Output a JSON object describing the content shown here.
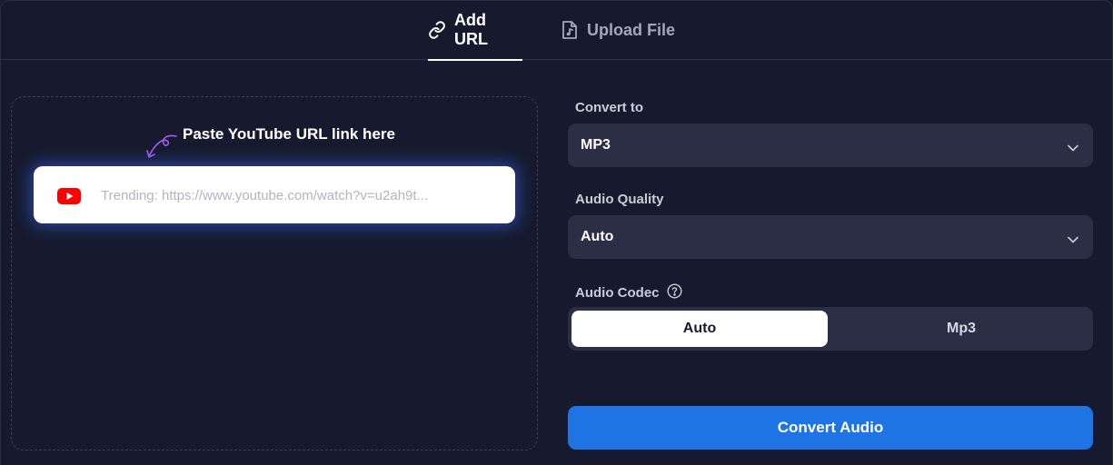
{
  "tabs": [
    {
      "label": "Add URL",
      "icon": "link-icon",
      "active": true
    },
    {
      "label": "Upload File",
      "icon": "music-file-icon",
      "active": false
    }
  ],
  "url_panel": {
    "hint": "Paste YouTube URL link here",
    "placeholder": "Trending: https://www.youtube.com/watch?v=u2ah9t...",
    "icon": "youtube-icon"
  },
  "convert_to": {
    "label": "Convert to",
    "value": "MP3"
  },
  "audio_quality": {
    "label": "Audio Quality",
    "value": "Auto"
  },
  "audio_codec": {
    "label": "Audio Codec",
    "options": [
      "Auto",
      "Mp3"
    ],
    "selected": "Auto"
  },
  "convert_button": {
    "label": "Convert Audio"
  },
  "colors": {
    "background": "#171a2e",
    "control": "#2b2e45",
    "accent": "#1f74e4",
    "youtube_red": "#ff0000"
  }
}
